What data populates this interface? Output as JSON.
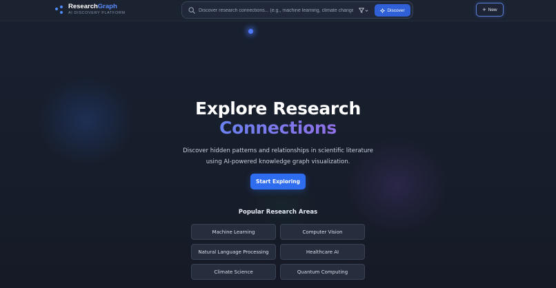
{
  "header": {
    "brand_main": "Research",
    "brand_accent": "Graph",
    "brand_subtitle": "AI DISCOVERY PLATFORM",
    "search_placeholder": "Discover research connections... (e.g., machine learning, climate change)",
    "search_value": "",
    "discover_label": "Discover",
    "new_label": "New"
  },
  "hero": {
    "title_line1": "Explore Research",
    "title_line2": "Connections",
    "description": "Discover hidden patterns and relationships in scientific literature using AI-powered knowledge graph visualization.",
    "cta_label": "Start Exploring"
  },
  "popular": {
    "heading": "Popular Research Areas",
    "areas": [
      "Machine Learning",
      "Computer Vision",
      "Natural Language Processing",
      "Healthcare AI",
      "Climate Science",
      "Quantum Computing"
    ]
  },
  "icons": {
    "logo": "graph-dots-icon",
    "search": "search-icon",
    "filter": "filter-icon",
    "filter_chevron": "chevron-down-icon",
    "discover": "sparkle-icon",
    "new": "plus-icon"
  },
  "colors": {
    "accent": "#2f6df0",
    "brand_accent": "#5b8cff",
    "title_gradient_start": "#6a82f0",
    "title_gradient_end": "#9070e6",
    "background": "#161c29"
  }
}
